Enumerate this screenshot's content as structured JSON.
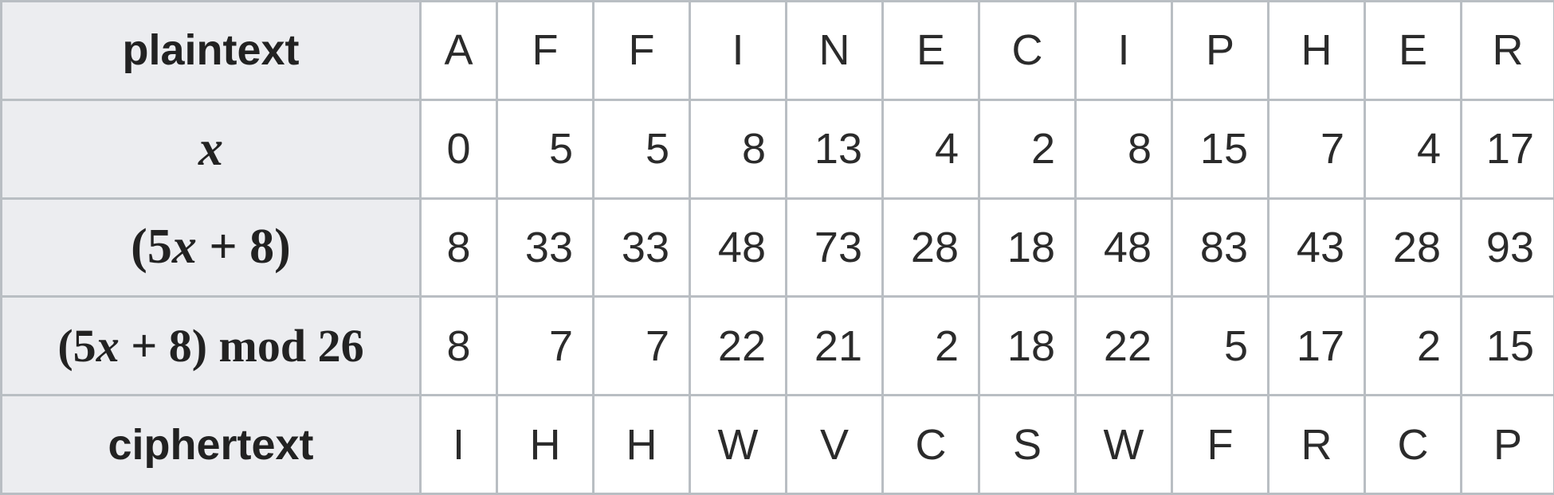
{
  "table": {
    "row_headers": {
      "plaintext": "plaintext",
      "x_var": "x",
      "expr_open": "(5",
      "expr_var": "x",
      "expr_close": " + 8)",
      "mod_open": "(5",
      "mod_var": "x",
      "mod_close": " + 8) mod 26",
      "ciphertext": "ciphertext"
    },
    "plaintext": [
      "A",
      "F",
      "F",
      "I",
      "N",
      "E",
      "C",
      "I",
      "P",
      "H",
      "E",
      "R"
    ],
    "x": [
      "0",
      "5",
      "5",
      "8",
      "13",
      "4",
      "2",
      "8",
      "15",
      "7",
      "4",
      "17"
    ],
    "linear": [
      "8",
      "33",
      "33",
      "48",
      "73",
      "28",
      "18",
      "48",
      "83",
      "43",
      "28",
      "93"
    ],
    "mod26": [
      "8",
      "7",
      "7",
      "22",
      "21",
      "2",
      "18",
      "22",
      "5",
      "17",
      "2",
      "15"
    ],
    "ciphertext": [
      "I",
      "H",
      "H",
      "W",
      "V",
      "C",
      "S",
      "W",
      "F",
      "R",
      "C",
      "P"
    ]
  },
  "colors": {
    "header_background": "#ecedf0",
    "grid_line": "#b9bec3",
    "text": "#2b2b2b"
  }
}
